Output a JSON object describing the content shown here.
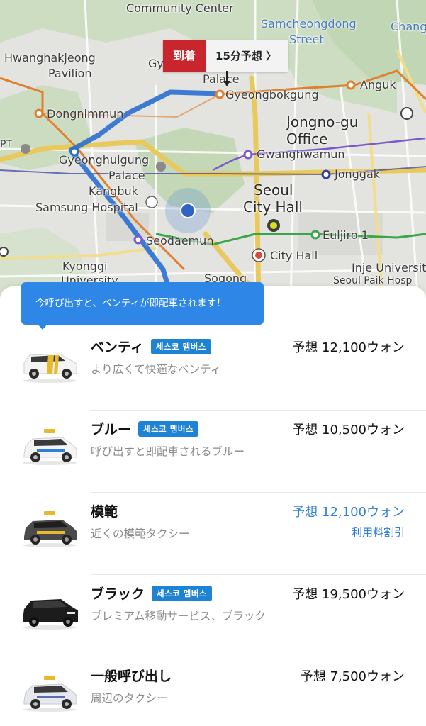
{
  "map": {
    "labels": {
      "community_center": "Community Center",
      "samcheongdong": "Samcheongdong",
      "street": "Street",
      "changd": "Chang",
      "hwanghakjeong": "Hwanghakjeong",
      "pavilion": "Pavilion",
      "gy": "Gy",
      "palace_top": "Palace",
      "gyeongbokgung": "Gyeongbokgung",
      "anguk": "Anguk",
      "dongnimmun": "Dongnimmun",
      "jongno_gu": "Jongno-gu",
      "office": "Office",
      "gwanghwamun": "Gwanghwamun",
      "gyeonghuigung": "Gyeonghuigung",
      "palace": "Palace",
      "jonggak": "Jonggak",
      "kangbuk": "Kangbuk",
      "samsung_hospital": "Samsung Hospital",
      "seoul": "Seoul",
      "city_hall_big": "City Hall",
      "euljiro": "Euljiro 1",
      "seodaemun": "Seodaemun",
      "kyonggi": "Kyonggi",
      "university": "University",
      "city_hall": "City Hall",
      "inje": "Inje Universit",
      "seoul_paik": "Seoul Paik Hosp",
      "sogong": "Sogong",
      "pt": "PT"
    }
  },
  "eta": {
    "arrive_label": "到着",
    "estimate_label": "15分予想 〉"
  },
  "tooltip": {
    "text": "今呼び出すと、ベンティが即配車されます！"
  },
  "rides": [
    {
      "name": "ベンティ",
      "badge": "세스코 멤버스",
      "desc": "より広くて快適なベンティ",
      "price": "予想 12,100ウォン",
      "sub": ""
    },
    {
      "name": "ブルー",
      "badge": "세스코 멤버스",
      "desc": "呼び出すと即配車されるブルー",
      "price": "予想 10,500ウォン",
      "sub": ""
    },
    {
      "name": "模範",
      "badge": "",
      "desc": "近くの模範タクシー",
      "price": "予想 12,100ウォン",
      "sub": "利用料割引"
    },
    {
      "name": "ブラック",
      "badge": "세스코 멤버스",
      "desc": "プレミアム移動サービス、ブラック",
      "price": "予想 19,500ウォン",
      "sub": ""
    },
    {
      "name": "一般呼び出し",
      "badge": "",
      "desc": "周辺のタクシー",
      "price": "予想 7,500ウォン",
      "sub": ""
    }
  ],
  "colors": {
    "accent_blue": "#2e87e6",
    "badge_blue": "#1e83d2",
    "eta_red": "#c8262c",
    "route_blue": "#2a6fd0"
  }
}
